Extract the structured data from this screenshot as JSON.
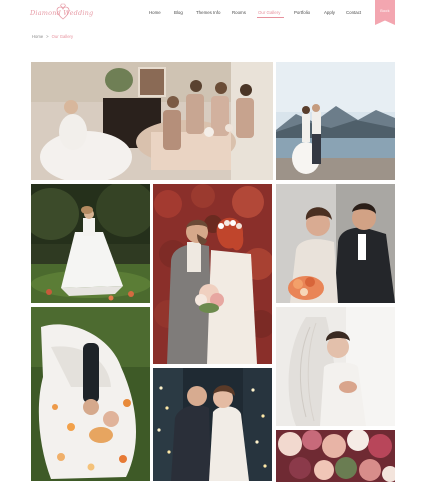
{
  "brand": {
    "name": "Diamond Wedding",
    "accent": "#e7919d"
  },
  "nav": {
    "items": [
      {
        "label": "Home"
      },
      {
        "label": "Blog"
      },
      {
        "label": "Themes Info"
      },
      {
        "label": "Rooms"
      },
      {
        "label": "Our Gallery",
        "active": true
      },
      {
        "label": "Portfolio"
      },
      {
        "label": "Apply"
      },
      {
        "label": "Contact"
      }
    ],
    "cta": "Book"
  },
  "breadcrumb": {
    "home": "Home",
    "separator": ">",
    "current": "Our Gallery"
  },
  "gallery": {
    "photos": [
      {
        "subject": "bride with bridesmaids in living room"
      },
      {
        "subject": "couple by the lake and mountains"
      },
      {
        "subject": "bride twirling dress in garden"
      },
      {
        "subject": "couple embracing in front of red ivy wall"
      },
      {
        "subject": "bride and groom close portrait"
      },
      {
        "subject": "couple lying on grass from above"
      },
      {
        "subject": "bride with lace veil"
      },
      {
        "subject": "couple dancing in string lights"
      },
      {
        "subject": "bridal bouquet close-up"
      }
    ]
  }
}
